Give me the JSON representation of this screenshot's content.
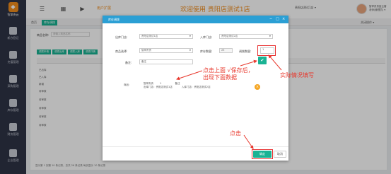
{
  "app": {
    "logo_text": "智掌贵云"
  },
  "sidebar": {
    "items": [
      {
        "label": "新办登记",
        "icon": "register-icon"
      },
      {
        "label": "充值管理",
        "icon": "recharge-icon"
      },
      {
        "label": "采购管理",
        "icon": "purchase-icon"
      },
      {
        "label": "库存管理",
        "icon": "inventory-icon"
      },
      {
        "label": "财务管理",
        "icon": "finance-icon"
      },
      {
        "label": "企业管理",
        "icon": "company-icon"
      }
    ]
  },
  "topbar": {
    "user_ext": "用户扩展",
    "welcome": "欢迎使用  贵阳店测试1店",
    "store_select": "贵阳店测试1店 ▾",
    "user_name_1": "智掌贵贵医云管",
    "user_name_2": "老师(管理员) ▾"
  },
  "tabs": [
    {
      "label": "首页"
    },
    {
      "label": "库存调拨"
    }
  ],
  "background": {
    "filter_label": "商品名称:",
    "filter_placeholder": "请输入商品名称",
    "buttons": [
      "调拨申请",
      "调拨出库",
      "调拨入库",
      "调拨详情"
    ],
    "rows": [
      "已出库",
      "已入库",
      "新增",
      "待审核",
      "待审核",
      "待审核",
      "待审核",
      "待审核"
    ],
    "footer": "显示第 1 到第 10 条记录，总共 26 条记录 每页显示 10 条记录",
    "close_label": "关闭操作 ▾"
  },
  "modal": {
    "title": "库存调拨",
    "out_store_label": "出库门店:",
    "out_store_value": "贵阳店测试1店",
    "in_store_label": "入库门店:",
    "in_store_value": "贵阳店测试2店",
    "product_label": "商品选择:",
    "product_value": "智掌贵贵",
    "stock_label": "库存数量:",
    "stock_value": "25",
    "transfer_qty_label": "调拨数量:",
    "transfer_qty_value": "1",
    "remark_label": "备注:",
    "remark_value": "备注",
    "item_label": "商品:",
    "item_name": "智掌贵贵",
    "item_qty": "1",
    "item_remark": "备注",
    "item_out_store": "出库门店：贵阳店测试1店",
    "item_in_store": "入库门店：贵阳店测试2店",
    "save_icon": "check-icon",
    "confirm_label": "确定",
    "cancel_label": "取消"
  },
  "annotations": {
    "note_save": "点击上面 √保存后，出现下面数据",
    "note_fill": "实际情况填写",
    "note_click": "点击"
  },
  "colors": {
    "sidebar_bg": "#2e3446",
    "accent": "#1ab394",
    "brand_orange": "#f08c1c",
    "modal_header": "#2b9fd4",
    "annotation_red": "#e8382d"
  }
}
